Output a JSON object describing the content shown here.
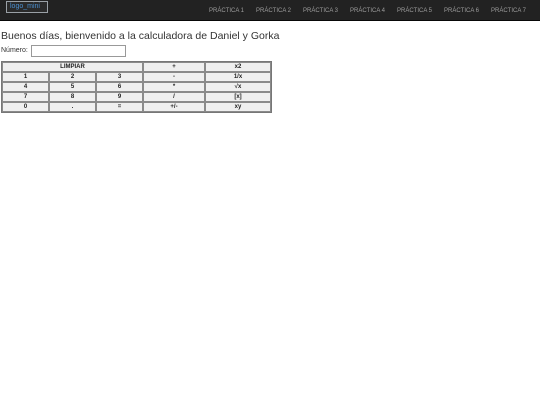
{
  "nav": {
    "logo_alt": "logo_mini",
    "items": [
      "PRÁCTICA 1",
      "PRÁCTICA 2",
      "PRÁCTICA 3",
      "PRÁCTICA 4",
      "PRÁCTICA 5",
      "PRÁCTICA 6",
      "PRÁCTICA 7"
    ]
  },
  "greeting": "Buenos días, bienvenido a la calculadora de Daniel y Gorka",
  "number_label": "Número:",
  "number_value": "",
  "calc": {
    "clear": "LIMPIAR",
    "rows": [
      [
        "1",
        "2",
        "3",
        "-",
        "1/x"
      ],
      [
        "4",
        "5",
        "6",
        "*",
        "√x"
      ],
      [
        "7",
        "8",
        "9",
        "/",
        "[x]"
      ],
      [
        "0",
        ".",
        "=",
        "+/-",
        "xy"
      ]
    ],
    "top_ops": [
      "+",
      "x2"
    ]
  }
}
